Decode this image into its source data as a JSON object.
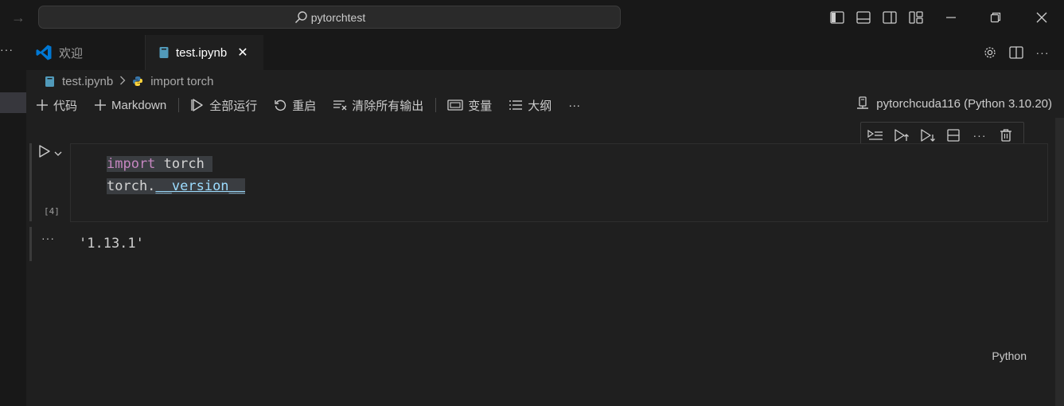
{
  "titlebar": {
    "search_text": "pytorchtest"
  },
  "tabs": [
    {
      "label": "欢迎"
    },
    {
      "label": "test.ipynb"
    }
  ],
  "breadcrumb": {
    "file": "test.ipynb",
    "symbol": "import torch"
  },
  "toolbar": {
    "add_code": "代码",
    "add_markdown": "Markdown",
    "run_all": "全部运行",
    "restart": "重启",
    "clear_outputs": "清除所有输出",
    "variables": "变量",
    "outline": "大纲",
    "more": "···"
  },
  "kernel": {
    "label": "pytorchcuda116 (Python 3.10.20)"
  },
  "cell": {
    "execution_count": "[4]",
    "language": "Python",
    "line1_keyword": "import",
    "line1_rest": " torch ",
    "line2_obj": "torch.",
    "line2_attr": "__version__"
  },
  "output": {
    "dots": "···",
    "text": "'1.13.1'"
  },
  "colors": {
    "accent": "#0078d4",
    "keyword": "#c586c0",
    "attribute": "#9cdcfe",
    "background": "#1f1f1f"
  }
}
